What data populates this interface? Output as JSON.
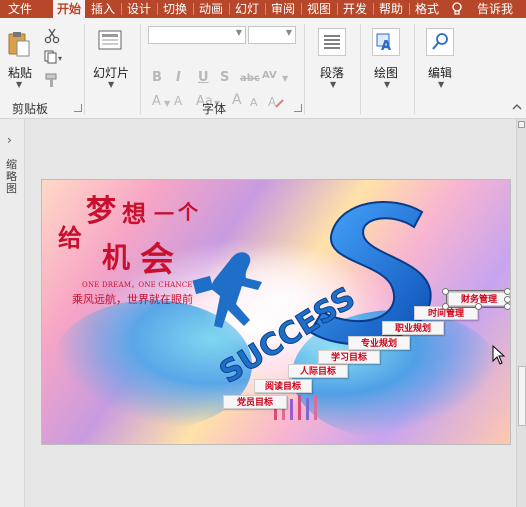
{
  "tabs": [
    {
      "label": "文件",
      "active": false
    },
    {
      "label": "开始",
      "active": true
    },
    {
      "label": "插入",
      "active": false
    },
    {
      "label": "设计",
      "active": false
    },
    {
      "label": "切换",
      "active": false
    },
    {
      "label": "动画",
      "active": false
    },
    {
      "label": "幻灯",
      "active": false
    },
    {
      "label": "审阅",
      "active": false
    },
    {
      "label": "视图",
      "active": false
    },
    {
      "label": "开发",
      "active": false
    },
    {
      "label": "帮助",
      "active": false
    },
    {
      "label": "格式",
      "active": false
    }
  ],
  "tell_me": "告诉我",
  "clipboard": {
    "paste": "粘贴",
    "group": "剪贴板"
  },
  "slides": {
    "new_slide": "幻灯片"
  },
  "font": {
    "group": "字体",
    "font_name": "",
    "font_size": "",
    "bold": "B",
    "italic": "I",
    "underline": "U",
    "strike": "S",
    "abc": "abc",
    "spacing": "AV",
    "font_color": "A",
    "highlight": "A",
    "case": "Aa",
    "grow": "A",
    "shrink": "A"
  },
  "paragraph": {
    "label": "段落"
  },
  "drawing": {
    "label": "绘图"
  },
  "editing": {
    "label": "编辑"
  },
  "thumb_pane": "缩略图",
  "slide": {
    "title_chars": [
      "梦",
      "想",
      "一",
      "个",
      "给",
      "机",
      "会"
    ],
    "en": "ONE DREAM，ONE CHANCE",
    "sub": "乘风远航，世界就在眼前",
    "steps": [
      "党员目标",
      "阅读目标",
      "人际目标",
      "学习目标",
      "专业规划",
      "职业规划",
      "时间管理",
      "财务管理"
    ],
    "success": "SUCCESS",
    "colors": {
      "brand": "#b7472a",
      "title_red": "#c8102e",
      "step_red": "#d0021b",
      "blue": "#1f6fc8"
    }
  }
}
